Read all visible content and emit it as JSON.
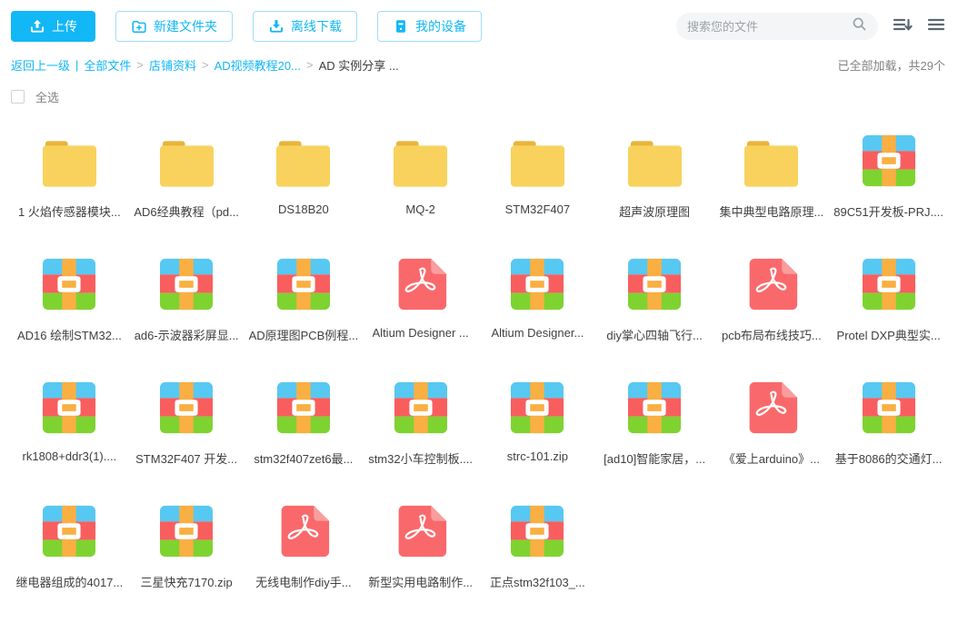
{
  "toolbar": {
    "upload_label": "上传",
    "new_folder_label": "新建文件夹",
    "offline_download_label": "离线下载",
    "my_devices_label": "我的设备",
    "search_placeholder": "搜索您的文件"
  },
  "breadcrumb": {
    "back_label": "返回上一级",
    "pipe_separator": "|",
    "gt_separator": ">",
    "links": [
      "全部文件",
      "店铺资料",
      "AD视频教程20..."
    ],
    "current": "AD 实例分享 ...",
    "load_status": "已全部加载，共29个"
  },
  "select_all_label": "全选",
  "colors": {
    "primary_blue": "#12b7f5",
    "button_border": "#9fdef9",
    "folder_body": "#f8d25c",
    "folder_tab": "#e8b43c",
    "archive_blue": "#57c8f2",
    "archive_red": "#f85e5e",
    "archive_green": "#7ed330",
    "archive_strap_orange": "#f9af42",
    "pdf_red": "#f9696b",
    "pdf_fold": "#fa9d9e"
  },
  "files": [
    {
      "name": "1 火焰传感器模块...",
      "type": "folder"
    },
    {
      "name": "AD6经典教程（pd...",
      "type": "folder"
    },
    {
      "name": "DS18B20",
      "type": "folder"
    },
    {
      "name": "MQ-2",
      "type": "folder"
    },
    {
      "name": "STM32F407",
      "type": "folder"
    },
    {
      "name": "超声波原理图",
      "type": "folder"
    },
    {
      "name": "集中典型电路原理...",
      "type": "folder"
    },
    {
      "name": "89C51开发板-PRJ....",
      "type": "rar"
    },
    {
      "name": "AD16 绘制STM32...",
      "type": "rar"
    },
    {
      "name": "ad6-示波器彩屏显...",
      "type": "rar"
    },
    {
      "name": "AD原理图PCB例程...",
      "type": "rar"
    },
    {
      "name": "Altium Designer ...",
      "type": "pdf"
    },
    {
      "name": "Altium Designer...",
      "type": "rar"
    },
    {
      "name": "diy掌心四轴飞行...",
      "type": "rar"
    },
    {
      "name": "pcb布局布线技巧...",
      "type": "pdf"
    },
    {
      "name": "Protel DXP典型实...",
      "type": "rar"
    },
    {
      "name": "rk1808+ddr3(1)....",
      "type": "rar"
    },
    {
      "name": "STM32F407 开发...",
      "type": "rar"
    },
    {
      "name": "stm32f407zet6最...",
      "type": "rar"
    },
    {
      "name": "stm32小车控制板....",
      "type": "rar"
    },
    {
      "name": "strc-101.zip",
      "type": "rar"
    },
    {
      "name": "[ad10]智能家居，...",
      "type": "rar"
    },
    {
      "name": "《爱上arduino》...",
      "type": "pdf"
    },
    {
      "name": "基于8086的交通灯...",
      "type": "rar"
    },
    {
      "name": "继电器组成的4017...",
      "type": "rar"
    },
    {
      "name": "三星快充7170.zip",
      "type": "rar"
    },
    {
      "name": "无线电制作diy手...",
      "type": "pdf"
    },
    {
      "name": "新型实用电路制作...",
      "type": "pdf"
    },
    {
      "name": "正点stm32f103_...",
      "type": "rar"
    }
  ]
}
